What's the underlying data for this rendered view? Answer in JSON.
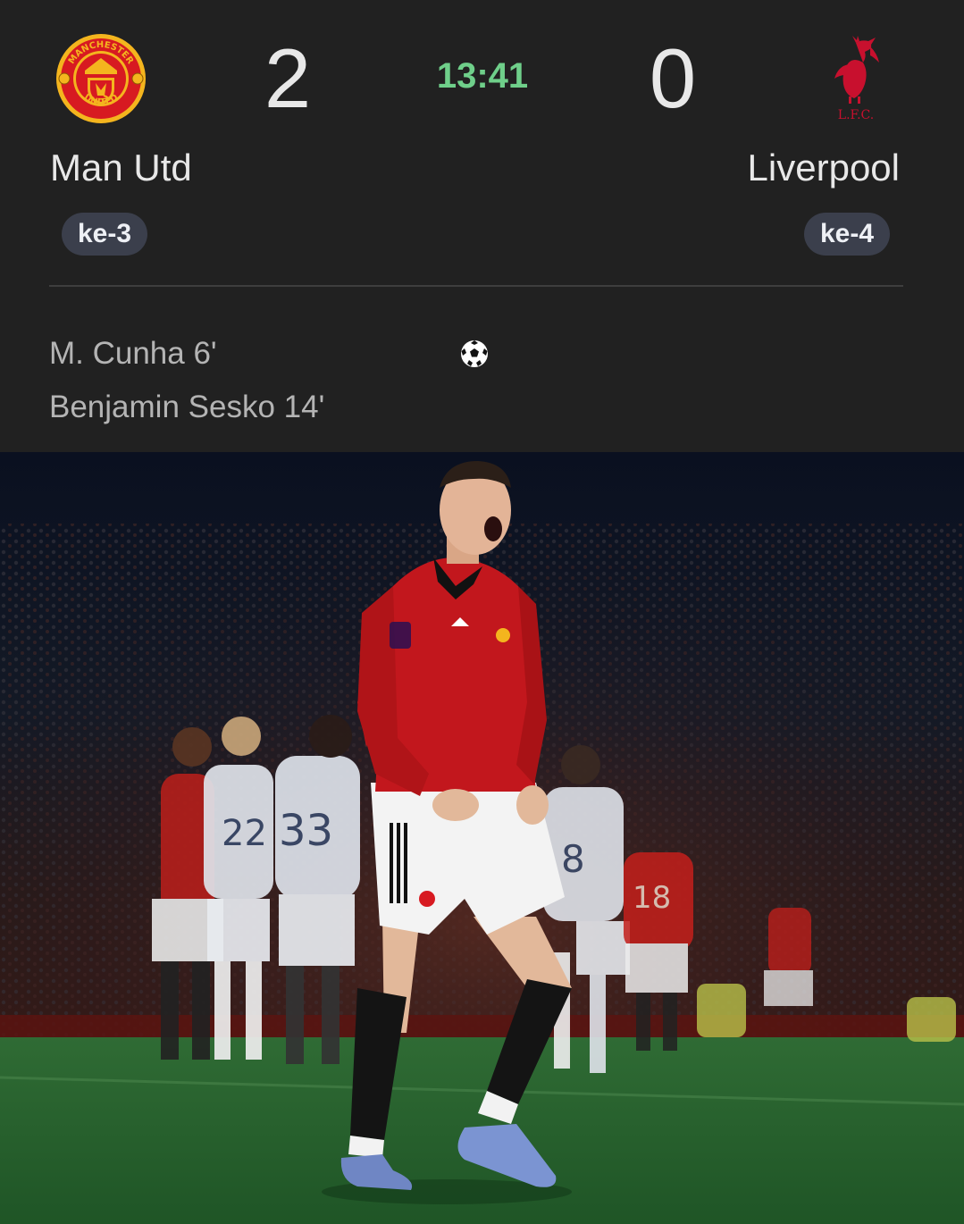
{
  "match": {
    "home": {
      "name": "Man Utd",
      "score": "2",
      "rank": "ke-3",
      "crest_icon": "man-utd-crest-icon",
      "color": "#da291c"
    },
    "away": {
      "name": "Liverpool",
      "score": "0",
      "rank": "ke-4",
      "crest_icon": "liverpool-crest-icon",
      "color": "#c8102e"
    },
    "clock": "13:41",
    "clock_color": "#6fcf8a",
    "goals_icon": "soccer-ball-icon",
    "home_goals": [
      "M. Cunha 6'",
      "Benjamin Sesko 14'"
    ]
  },
  "crest_text": {
    "home_top": "MANCHESTER",
    "home_bottom": "UNITED",
    "away": "L.F.C."
  },
  "photo": {
    "subject": "player-celebration-photo",
    "jersey_numbers": [
      "22",
      "33",
      "8",
      "18"
    ]
  }
}
